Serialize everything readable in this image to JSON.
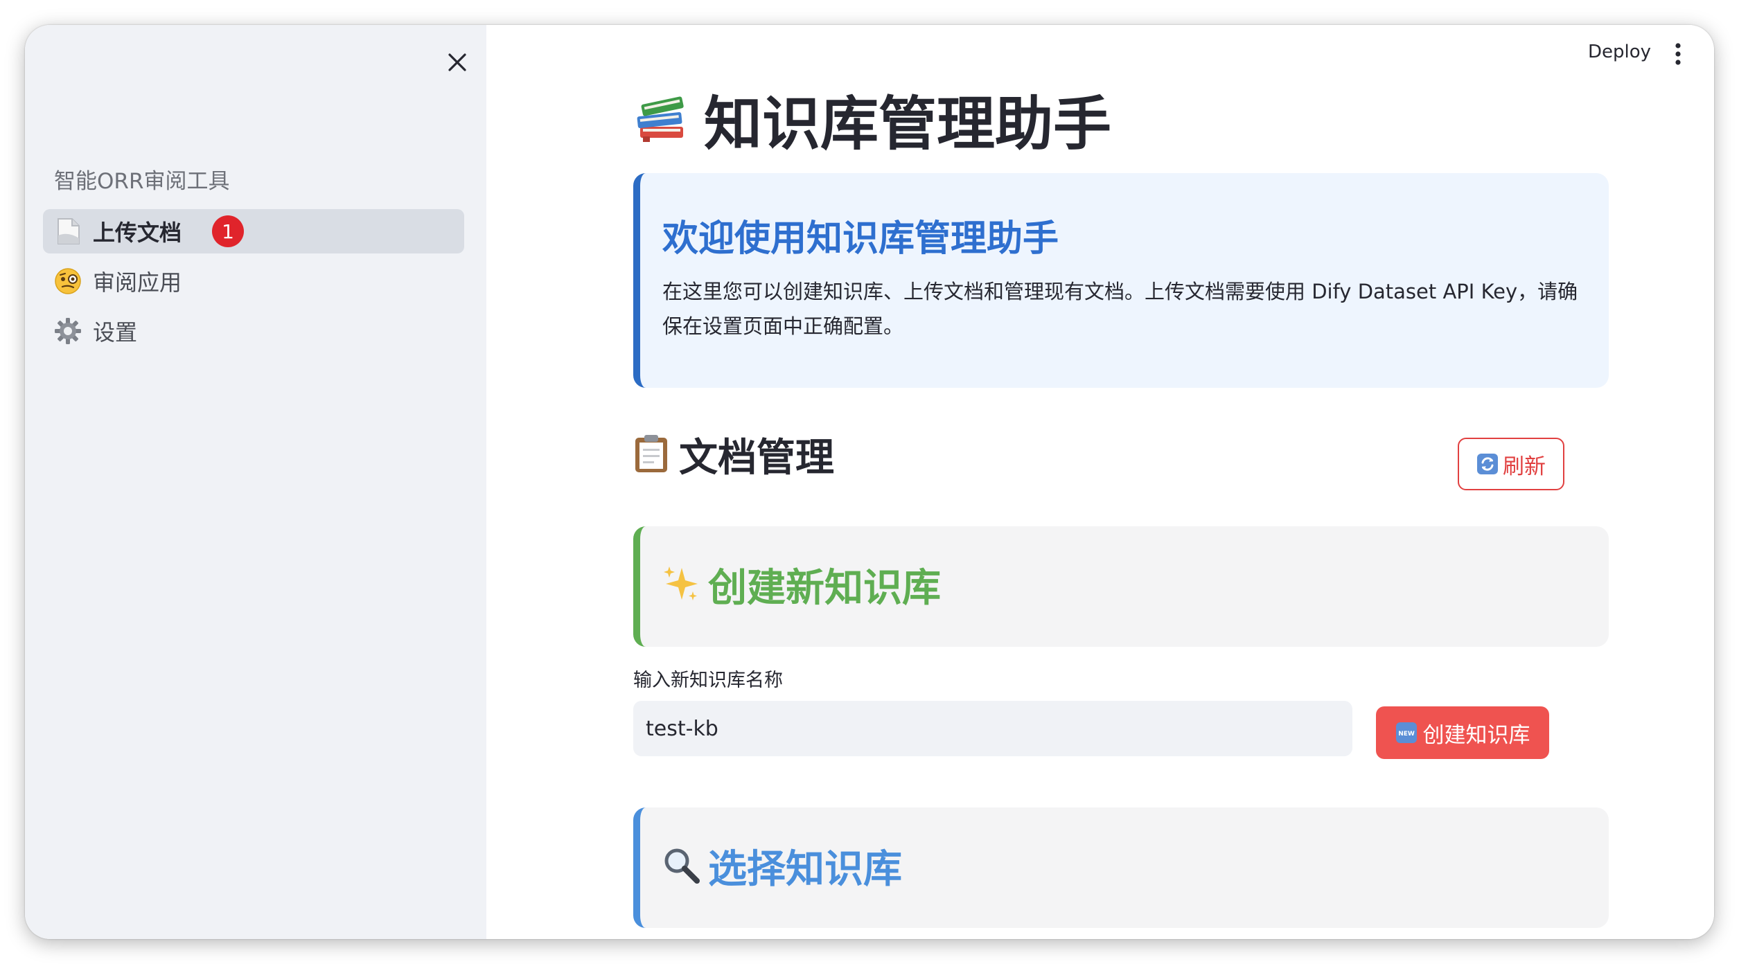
{
  "sidebar": {
    "app_title": "智能ORR审阅工具",
    "items": [
      {
        "label": "上传文档",
        "icon": "page-icon",
        "active": true,
        "badge": "1"
      },
      {
        "label": "审阅应用",
        "icon": "monocle-face-icon",
        "active": false
      },
      {
        "label": "设置",
        "icon": "gear-icon",
        "active": false
      }
    ]
  },
  "header": {
    "deploy_label": "Deploy"
  },
  "main": {
    "title": "知识库管理助手",
    "info_card": {
      "title": "欢迎使用知识库管理助手",
      "description": "在这里您可以创建知识库、上传文档和管理现有文档。上传文档需要使用 Dify Dataset API Key，请确保在设置页面中正确配置。"
    },
    "doc_section": {
      "title": "文档管理",
      "refresh_label": "刷新"
    },
    "create_section": {
      "title": "创建新知识库",
      "input_label": "输入新知识库名称",
      "input_value": "test-kb",
      "button_label": "创建知识库"
    },
    "select_section": {
      "title": "选择知识库"
    }
  },
  "colors": {
    "accent_red": "#ef5350",
    "info_blue": "#2e6fcf",
    "success_green": "#5fae52",
    "select_blue": "#4a8fdc",
    "sidebar_bg": "#f0f2f6"
  }
}
